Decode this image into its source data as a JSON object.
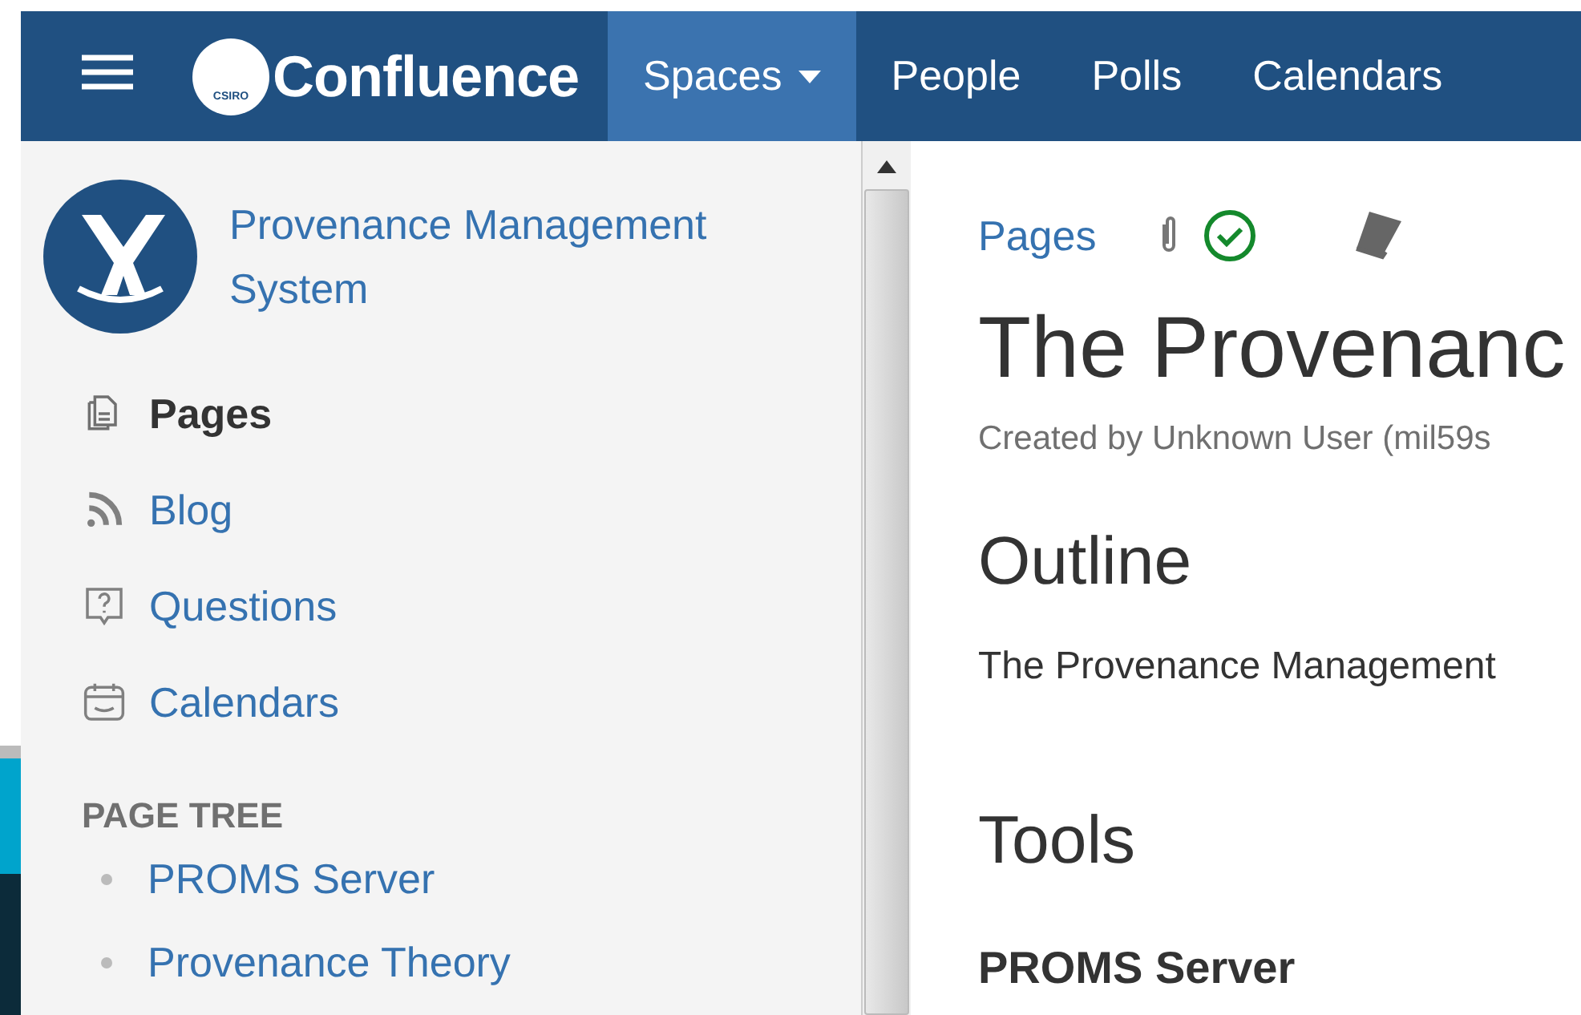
{
  "header": {
    "product": "Confluence",
    "logo_badge": "CSIRO",
    "nav": [
      {
        "label": "Spaces",
        "selected": true,
        "has_menu": true
      },
      {
        "label": "People",
        "selected": false,
        "has_menu": false
      },
      {
        "label": "Polls",
        "selected": false,
        "has_menu": false
      },
      {
        "label": "Calendars",
        "selected": false,
        "has_menu": false
      }
    ]
  },
  "sidebar": {
    "space_name": "Provenance Management System",
    "items": [
      {
        "label": "Pages",
        "kind": "pages",
        "selected": true
      },
      {
        "label": "Blog",
        "kind": "blog",
        "selected": false
      },
      {
        "label": "Questions",
        "kind": "questions",
        "selected": false
      },
      {
        "label": "Calendars",
        "kind": "calendars",
        "selected": false
      }
    ],
    "page_tree": {
      "title": "PAGE TREE",
      "items": [
        {
          "label": "PROMS Server"
        },
        {
          "label": "Provenance Theory"
        }
      ]
    }
  },
  "content": {
    "breadcrumb": "Pages",
    "title": "The Provenanc",
    "byline": "Created by Unknown User (mil59s",
    "sections": [
      {
        "kind": "h2",
        "text": "Outline"
      },
      {
        "kind": "p",
        "text": "The Provenance Management"
      },
      {
        "kind": "h2",
        "text": "Tools"
      },
      {
        "kind": "h3",
        "text": "PROMS Server"
      }
    ]
  }
}
